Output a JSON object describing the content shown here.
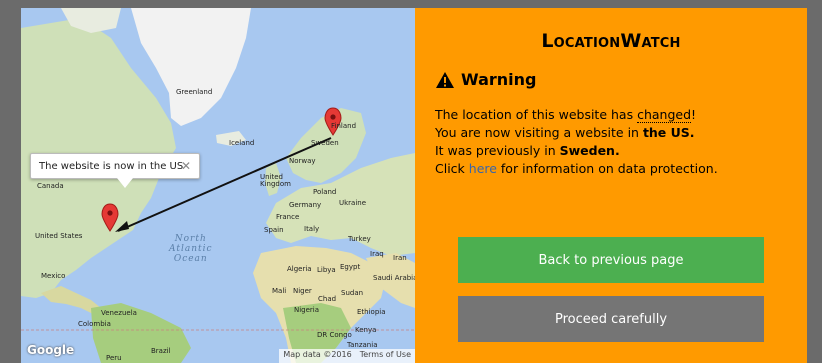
{
  "dialog": {
    "title": "LocationWatch",
    "warning_label": "Warning",
    "message": {
      "line1_pre": "The location of this website has ",
      "line1_changed": "changed",
      "line1_post": "!",
      "line2_pre": "You are now visiting a website in ",
      "line2_bold": "the US.",
      "line3_pre": "It was previously in ",
      "line3_bold": "Sweden.",
      "line4_pre": "Click ",
      "line4_link": "here",
      "line4_post": " for information on data protection."
    },
    "back_button": "Back to previous page",
    "proceed_button": "Proceed carefully"
  },
  "map": {
    "popup_text": "The website is now in the US",
    "popup_close": "✕",
    "labels": {
      "greenland": "Greenland",
      "iceland": "Iceland",
      "finland": "Finland",
      "sweden": "Sweden",
      "norway": "Norway",
      "united_kingdom_1": "United",
      "united_kingdom_2": "Kingdom",
      "poland": "Poland",
      "germany": "Germany",
      "ukraine": "Ukraine",
      "france": "France",
      "spain": "Spain",
      "italy": "Italy",
      "turkey": "Turkey",
      "iraq": "Iraq",
      "iran": "Iran",
      "canada": "Canada",
      "united_states": "United States",
      "mexico": "Mexico",
      "algeria": "Algeria",
      "libya": "Libya",
      "egypt": "Egypt",
      "saudi_arabia": "Saudi Arabia",
      "mali": "Mali",
      "niger": "Niger",
      "chad": "Chad",
      "sudan": "Sudan",
      "nigeria": "Nigeria",
      "ethiopia": "Ethiopia",
      "venezuela": "Venezuela",
      "colombia": "Colombia",
      "dr_congo": "DR Congo",
      "kenya": "Kenya",
      "tanzania": "Tanzania",
      "brazil": "Brazil",
      "peru": "Peru"
    },
    "ocean_label": "North\nAtlantic\nOcean",
    "google_logo": "Google",
    "attribution_data": "Map data ©2016",
    "attribution_terms": "Terms of Use"
  },
  "colors": {
    "panel": "#ff9a00",
    "back_button": "#4caf50",
    "proceed_button": "#757575",
    "link": "#3a66a8",
    "marker": "#e53935"
  }
}
